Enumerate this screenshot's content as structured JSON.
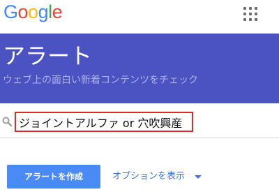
{
  "logo": {
    "letters": [
      {
        "char": "G",
        "color": "#4285F4"
      },
      {
        "char": "o",
        "color": "#EA4335"
      },
      {
        "char": "o",
        "color": "#FBBC05"
      },
      {
        "char": "g",
        "color": "#4285F4"
      },
      {
        "char": "l",
        "color": "#34A853"
      },
      {
        "char": "e",
        "color": "#EA4335"
      }
    ]
  },
  "header": {
    "apps_icon": "apps-grid-icon"
  },
  "banner": {
    "title": "アラート",
    "subtitle": "ウェブ上の面白い新着コンテンツをチェック",
    "color": "#4b52c2"
  },
  "search": {
    "value": "ジョイントアルファ or 穴吹興産",
    "icon": "search-icon"
  },
  "actions": {
    "create_label": "アラートを作成",
    "options_label": "オプションを表示",
    "options_icon": "caret-down-icon",
    "accent": "#4a8af4"
  }
}
